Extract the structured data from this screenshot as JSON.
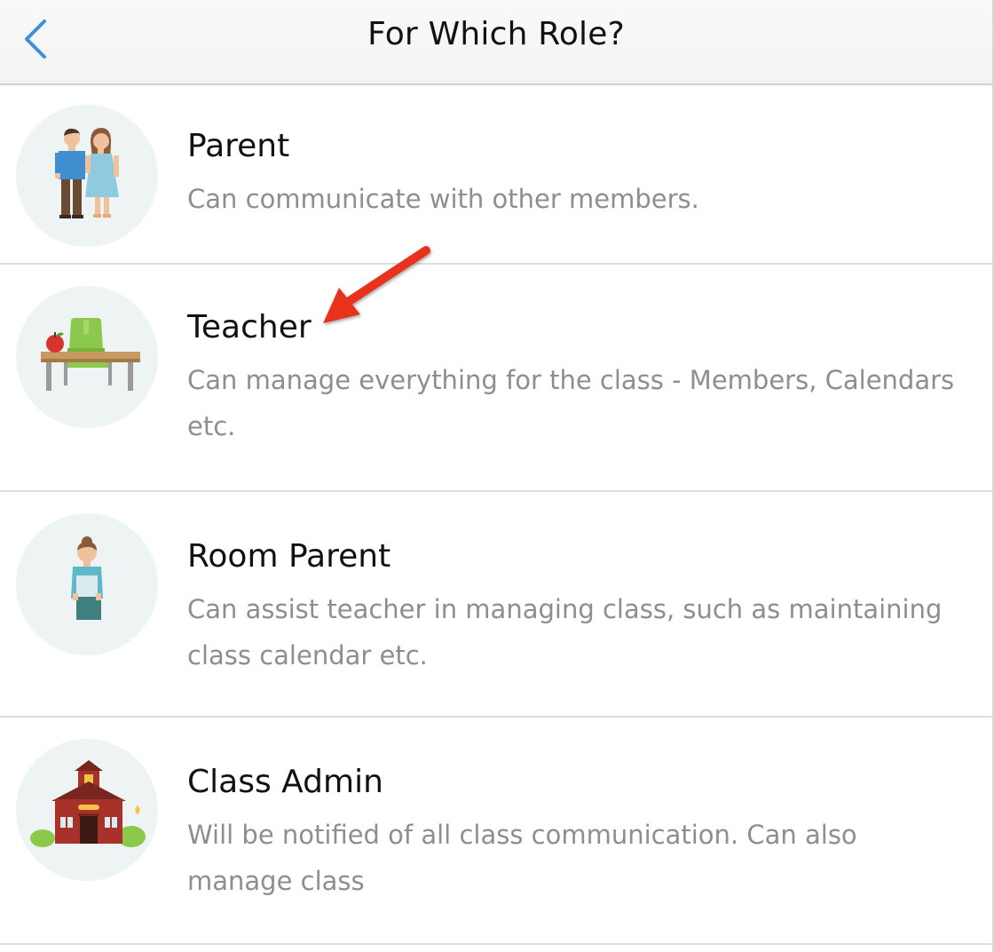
{
  "nav": {
    "title": "For Which Role?",
    "back_icon": "chevron-left-icon",
    "accent_color": "#3d8fd6"
  },
  "roles": [
    {
      "name": "Parent",
      "description": "Can communicate with other members.",
      "icon": "parents-icon"
    },
    {
      "name": "Teacher",
      "description": "Can manage everything for the class - Members, Calendars etc.",
      "icon": "teacher-desk-icon"
    },
    {
      "name": "Room Parent",
      "description": "Can assist teacher in managing class, such as maintaining class calendar etc.",
      "icon": "room-parent-icon"
    },
    {
      "name": "Class Admin",
      "description": "Will be notified of all class communication. Can also manage class",
      "icon": "schoolhouse-icon"
    }
  ],
  "annotation": {
    "icon": "red-arrow-icon",
    "color": "#e8301c"
  }
}
